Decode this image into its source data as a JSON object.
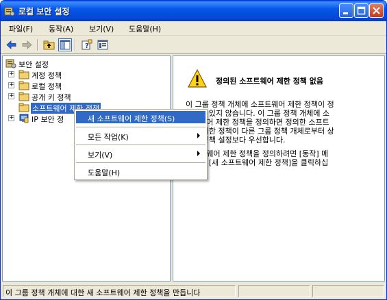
{
  "window": {
    "title": "로컬 보안 설정",
    "minimize_icon": "minimize-icon",
    "maximize_icon": "maximize-icon",
    "close_icon": "close-icon"
  },
  "menu": {
    "items": [
      "파일(F)",
      "동작(A)",
      "보기(V)",
      "도움말(H)"
    ]
  },
  "toolbar": {
    "icons": [
      "back-arrow-icon",
      "forward-arrow-icon",
      "up-folder-icon",
      "show-hide-tree-icon",
      "help-icon",
      "properties-icon"
    ]
  },
  "tree": {
    "items": [
      {
        "label": "보안 설정",
        "icon": "security-settings-icon"
      },
      {
        "label": "계정 정책",
        "icon": "folder-icon"
      },
      {
        "label": "로컬 정책",
        "icon": "folder-icon"
      },
      {
        "label": "공개 키 정책",
        "icon": "folder-icon"
      },
      {
        "label": "소프트웨어 제한 정책",
        "icon": "folder-icon"
      },
      {
        "label": "IP 보안 정",
        "icon": "ip-security-icon"
      }
    ]
  },
  "details": {
    "warning_icon": "warning-icon",
    "title": "정의된 소프트웨어 제한 정책 없음",
    "paragraph1_lines": [
      "이 그룹 정책 개체에 소프트웨어 제한 정책이 정",
      "의되어 있지 않습니다. 이 그룹 정책 개체에 소",
      "프트웨어 제한 정책을 정의하면 정의한 소프트",
      "웨어 제한 정책이 다른 그룹 정책 개체로부터 상",
      "속된 정책 설정보다 우선합니다."
    ],
    "paragraph2_lines": [
      "소프트웨어 제한 정책을 정의하려면 [동작] 메",
      "뉴에서 [새 소프트웨어 제한 정책]을 클릭하십",
      "시오."
    ]
  },
  "context_menu": {
    "items": [
      {
        "label": "새 소프트웨어 제한 정책(S)",
        "submenu": false,
        "highlighted": true
      },
      {
        "label": "모든 작업(K)",
        "submenu": true,
        "highlighted": false
      },
      {
        "label": "보기(V)",
        "submenu": true,
        "highlighted": false
      },
      {
        "label": "도움말(H)",
        "submenu": false,
        "highlighted": false
      }
    ]
  },
  "status": {
    "text": "이 그룹 정책 개체에 대한 새 소프트웨어 제한 정책을 만듭니다"
  },
  "colors": {
    "title_bar": "#0757e8",
    "selection": "#316ac5",
    "folder": "#f3d06e"
  }
}
